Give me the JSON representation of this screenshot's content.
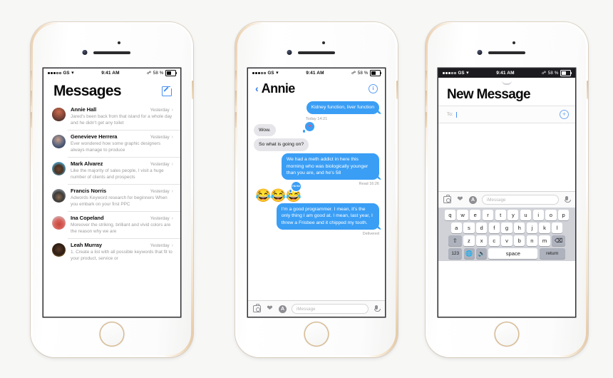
{
  "theme": {
    "page_background": "#f7f7f6",
    "bubble_out": "#3a9ef5",
    "bubble_in": "#e6e5e9",
    "accent_blue": "#4a90f0",
    "frame_gold": "#e2bf95"
  },
  "status_bar": {
    "carrier": "GS",
    "time": "9:41 AM",
    "battery_percent": "58 %",
    "wifi_icon": "wifi-icon",
    "bluetooth_icon": "bluetooth-icon",
    "signal_dots_filled": 3,
    "signal_dots_empty": 2
  },
  "phone1": {
    "title": "Messages",
    "compose_icon": "compose-icon",
    "conversations": [
      {
        "name": "Annie Hall",
        "time": "Yesterday",
        "preview": "Jared's been back from that island for a whole day and he didn't get any toilet",
        "avatar_color": "#8a4a3a"
      },
      {
        "name": "Genevieve Herrera",
        "time": "Yesterday",
        "preview": "Ever wondered how some graphic designers always manage to produce",
        "avatar_color": "#3f4c68"
      },
      {
        "name": "Mark Alvarez",
        "time": "Yesterday",
        "preview": "Like the majority of sales people, I visit a huge number of clients and prospects",
        "avatar_color": "#4fa3c7"
      },
      {
        "name": "Francis Norris",
        "time": "Yesterday",
        "preview": "Adwords Keyword research for beginners When you embark on your first PPC",
        "avatar_color": "#7d8da0"
      },
      {
        "name": "Ina Copeland",
        "time": "Yesterday",
        "preview": "Moreover the striking, brilliant and vivid colors are the reason why we are",
        "avatar_color": "#c4463f"
      },
      {
        "name": "Leah Murray",
        "time": "Yesterday",
        "preview": "1. Create a list with all possible keywords that fit to your product, service or",
        "avatar_color": "#d79a3c"
      }
    ]
  },
  "phone2": {
    "back_icon": "back-chevron-icon",
    "contact_name": "Annie",
    "info_icon": "info-icon",
    "timestamp": "Today 14:21",
    "messages": [
      {
        "side": "out",
        "text": "Kidney function, liver function"
      },
      {
        "side": "in",
        "text": "Wow.",
        "tapback": "heart"
      },
      {
        "side": "in",
        "text": "So what is going on?"
      },
      {
        "side": "out",
        "text": "We had a meth addict in here this morning who was biologically younger than you are, and he's 58",
        "status": "Read 16:26"
      },
      {
        "side": "emoji",
        "text": "😂😂😂",
        "tapback": "haha"
      },
      {
        "side": "out",
        "text": "I'm a good programmer. I mean, it's the only thing I am good at. I mean, last year, I threw a Frisbee and it chipped my tooth.",
        "status": "Delivered"
      }
    ],
    "tapback_haha_label": "HA HA",
    "toolbar": {
      "camera_icon": "camera-icon",
      "apps_icon": "digital-touch-icon",
      "appstore_icon": "app-store-icon",
      "input_placeholder": "iMessage",
      "mic_icon": "microphone-icon"
    }
  },
  "phone3": {
    "title": "New Message",
    "to_label": "To:",
    "to_value": "",
    "add_contact_icon": "add-contact-icon",
    "toolbar": {
      "camera_icon": "camera-icon",
      "apps_icon": "digital-touch-icon",
      "appstore_icon": "app-store-icon",
      "input_placeholder": "iMessage",
      "mic_icon": "microphone-icon"
    },
    "keyboard": {
      "row1": [
        "q",
        "w",
        "e",
        "r",
        "t",
        "y",
        "u",
        "i",
        "o",
        "p"
      ],
      "row2": [
        "a",
        "s",
        "d",
        "f",
        "g",
        "h",
        "j",
        "k",
        "l"
      ],
      "row3": [
        "z",
        "x",
        "c",
        "v",
        "b",
        "n",
        "m"
      ],
      "shift_icon": "shift-icon",
      "delete_icon": "backspace-icon",
      "numeric_key": "123",
      "globe_icon": "globe-icon",
      "mic_icon": "microphone-icon",
      "space_key": "space",
      "return_key": "return"
    }
  }
}
